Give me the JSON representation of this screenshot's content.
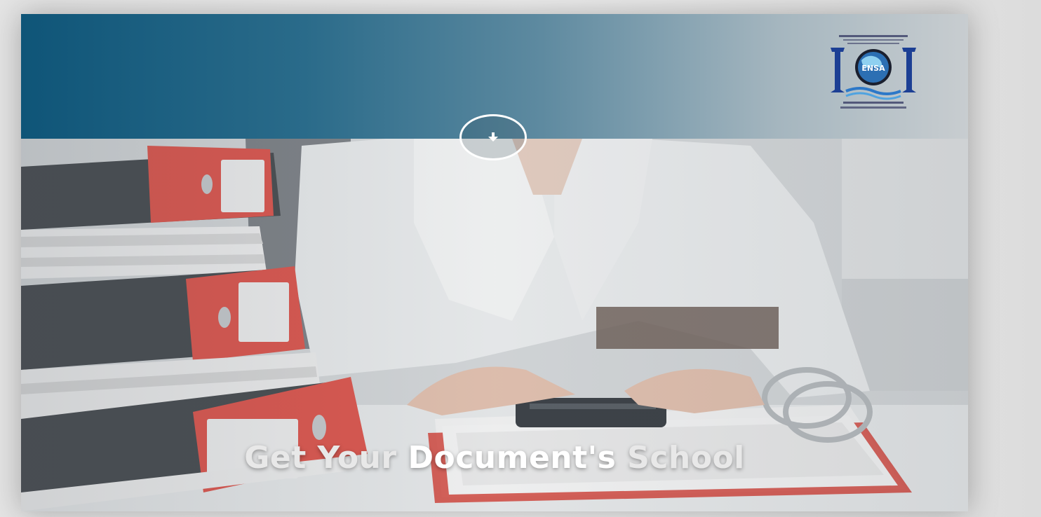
{
  "header": {
    "logo": {
      "icon": "ensa-logo",
      "text": "ENSA"
    },
    "scroll_button": {
      "icon": "arrow-down-icon"
    }
  },
  "hero": {
    "title_part1": "Get Your ",
    "title_part2": "Document's",
    "title_part3": " School"
  },
  "colors": {
    "header_start": "#0f5578",
    "header_end": "#c8cdd0",
    "binder_red": "#e0584f",
    "logo_blue": "#1c3f94"
  }
}
